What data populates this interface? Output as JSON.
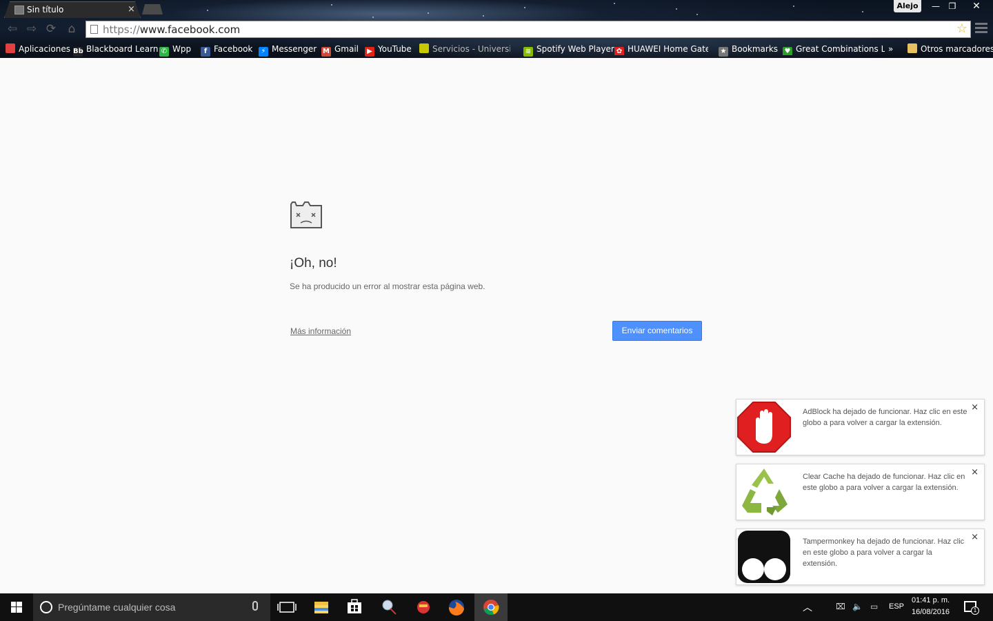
{
  "tab": {
    "title": "Sin título",
    "close_glyph": "×"
  },
  "window": {
    "profile": "Alejo",
    "min_glyph": "—",
    "max_glyph": "❐",
    "close_glyph": "✕"
  },
  "toolbar": {
    "back_glyph": "⇦",
    "forward_glyph": "⇨",
    "reload_glyph": "⟳",
    "home_glyph": "⌂"
  },
  "omnibox": {
    "scheme": "https://",
    "host": "www.facebook.com",
    "bookmark_glyph": "☆"
  },
  "bookmarks": [
    {
      "label": "Aplicaciones",
      "icon": "apps-grid-icon",
      "color": "#e04040"
    },
    {
      "label": "Blackboard Learn",
      "icon": "blackboard-icon",
      "color": "#222222"
    },
    {
      "label": "Wpp",
      "icon": "whatsapp-icon",
      "color": "#2db742"
    },
    {
      "label": "Facebook",
      "icon": "facebook-icon",
      "color": "#3b5998"
    },
    {
      "label": "Messenger",
      "icon": "messenger-icon",
      "color": "#0084ff"
    },
    {
      "label": "Gmail",
      "icon": "gmail-icon",
      "color": "#d14836"
    },
    {
      "label": "YouTube",
      "icon": "youtube-icon",
      "color": "#e62117"
    },
    {
      "label": "Servicios - Universida",
      "icon": "university-icon",
      "color": "#c8c800"
    },
    {
      "label": "Spotify Web Player",
      "icon": "spotify-icon",
      "color": "#84bd00"
    },
    {
      "label": "HUAWEI Home Gatew",
      "icon": "huawei-icon",
      "color": "#e02020"
    },
    {
      "label": "Bookmarks",
      "icon": "star-icon",
      "color": "#777777"
    },
    {
      "label": "Great Combinations La",
      "icon": "heart-icon",
      "color": "#2aa02a"
    }
  ],
  "bookmarks_overflow": "»",
  "other_bookmarks": "Otros marcadores",
  "error": {
    "title": "¡Oh, no!",
    "description": "Se ha producido un error al mostrar esta página web.",
    "more_info": "Más información",
    "feedback_button": "Enviar comentarios"
  },
  "notifications": [
    {
      "text": "AdBlock ha dejado de funcionar. Haz clic en este globo a para volver a cargar la extensión.",
      "icon": "adblock-icon"
    },
    {
      "text": "Clear Cache ha dejado de funcionar. Haz clic en este globo a para volver a cargar la extensión.",
      "icon": "recycle-icon"
    },
    {
      "text": "Tampermonkey ha dejado de funcionar. Haz clic en este globo a para volver a cargar la extensión.",
      "icon": "tampermonkey-icon"
    }
  ],
  "notification_close": "×",
  "taskbar": {
    "search_placeholder": "Pregúntame cualquier cosa",
    "language": "ESP",
    "time": "01:41 p. m.",
    "date": "16/08/2016",
    "notification_count": "1"
  },
  "colors": {
    "accent": "#4d90fe",
    "error_title": "#333333",
    "taskbar": "#101010"
  }
}
